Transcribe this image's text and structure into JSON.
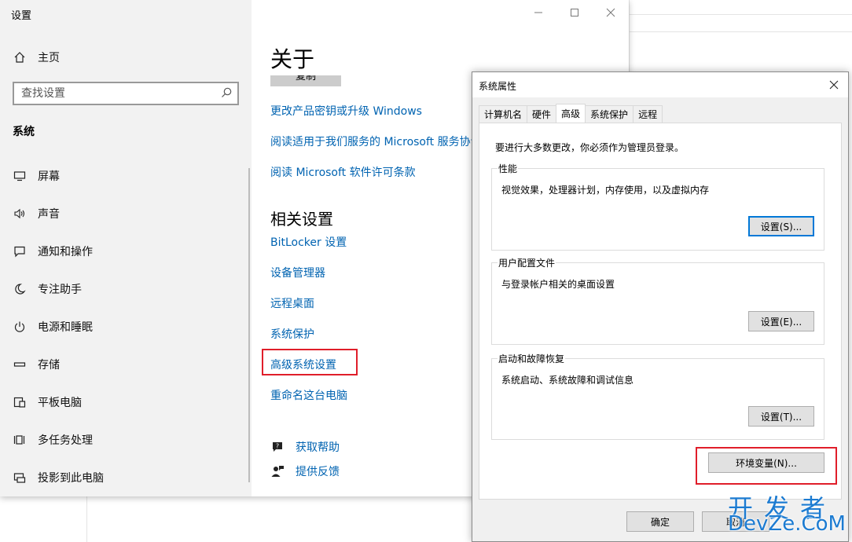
{
  "settings": {
    "window_title": "设置",
    "home": "主页",
    "search_placeholder": "查找设置",
    "section": "系统",
    "nav": [
      {
        "label": "屏幕",
        "icon": "monitor-icon"
      },
      {
        "label": "声音",
        "icon": "speaker-icon"
      },
      {
        "label": "通知和操作",
        "icon": "notification-icon"
      },
      {
        "label": "专注助手",
        "icon": "moon-icon"
      },
      {
        "label": "电源和睡眠",
        "icon": "power-icon"
      },
      {
        "label": "存储",
        "icon": "storage-icon"
      },
      {
        "label": "平板电脑",
        "icon": "tablet-icon"
      },
      {
        "label": "多任务处理",
        "icon": "multitask-icon"
      },
      {
        "label": "投影到此电脑",
        "icon": "project-icon"
      }
    ],
    "page_title": "关于",
    "copy_button": "复制",
    "links": [
      "更改产品密钥或升级 Windows",
      "阅读适用于我们服务的 Microsoft 服务协议",
      "阅读 Microsoft 软件许可条款"
    ],
    "related_title": "相关设置",
    "related_links": [
      "BitLocker 设置",
      "设备管理器",
      "远程桌面",
      "系统保护",
      "高级系统设置",
      "重命名这台电脑"
    ],
    "help": "获取帮助",
    "feedback": "提供反馈"
  },
  "dialog": {
    "title": "系统属性",
    "tabs": [
      "计算机名",
      "硬件",
      "高级",
      "系统保护",
      "远程"
    ],
    "active_tab": "高级",
    "admin_note": "要进行大多数更改，你必须作为管理员登录。",
    "performance": {
      "label": "性能",
      "desc": "视觉效果，处理器计划，内存使用，以及虚拟内存",
      "button": "设置(S)..."
    },
    "profiles": {
      "label": "用户配置文件",
      "desc": "与登录帐户相关的桌面设置",
      "button": "设置(E)..."
    },
    "startup": {
      "label": "启动和故障恢复",
      "desc": "系统启动、系统故障和调试信息",
      "button": "设置(T)..."
    },
    "env_button": "环境变量(N)...",
    "ok": "确定",
    "cancel": "取消"
  },
  "watermark": {
    "top": "开发者",
    "bottom": "DevZe.CoM"
  },
  "colors": {
    "link": "#0063b1",
    "highlight": "#e01e2a",
    "default_button_border": "#0078d7"
  }
}
